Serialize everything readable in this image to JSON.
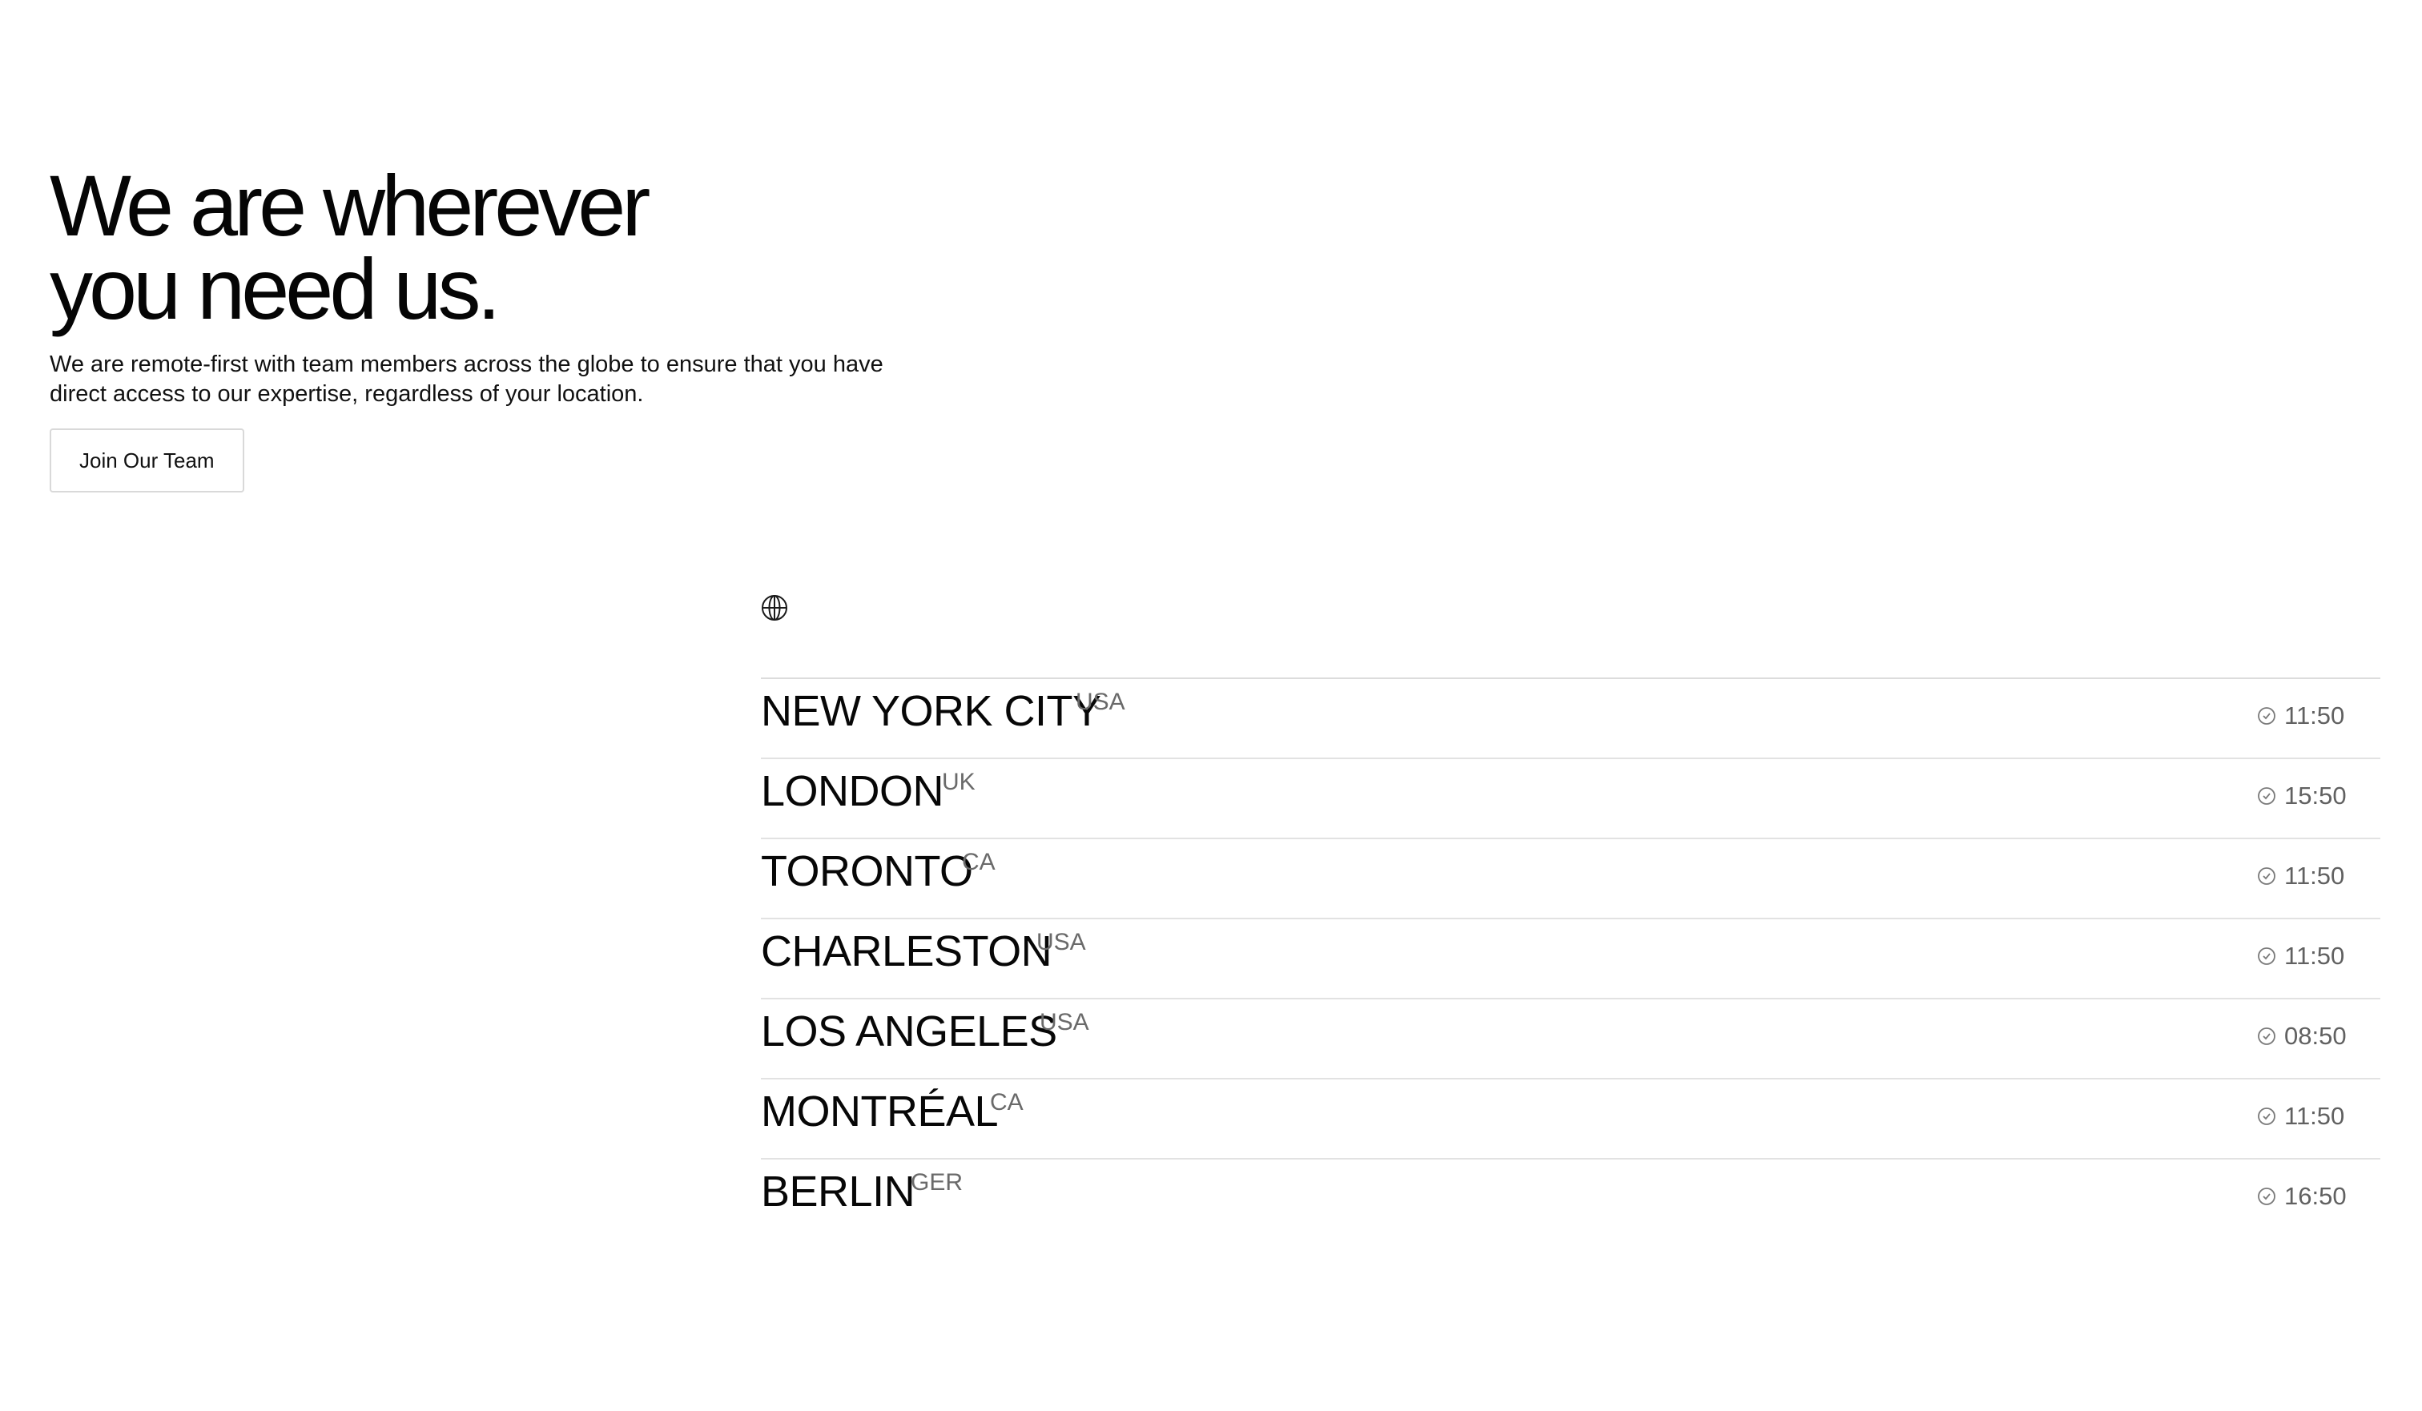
{
  "hero": {
    "title_line1": "We are wherever",
    "title_line2": "you need us.",
    "description": "We are remote-first with team members across the globe to ensure that you have direct access to our expertise, regardless of your location.",
    "cta_label": "Join Our Team"
  },
  "locations": {
    "icon": "globe-icon",
    "time_icon": "clock-icon",
    "cities": [
      {
        "name": "NEW YORK CITY",
        "country": "USA",
        "time": "11:50"
      },
      {
        "name": "LONDON",
        "country": "UK",
        "time": "15:50"
      },
      {
        "name": "TORONTO",
        "country": "CA",
        "time": "11:50"
      },
      {
        "name": "CHARLESTON",
        "country": "USA",
        "time": "11:50"
      },
      {
        "name": "LOS ANGELES",
        "country": "USA",
        "time": "08:50"
      },
      {
        "name": "MONTRÉAL",
        "country": "CA",
        "time": "11:50"
      },
      {
        "name": "BERLIN",
        "country": "GER",
        "time": "16:50"
      }
    ]
  },
  "colors": {
    "text": "#0b0b0b",
    "muted": "#6a6a6a",
    "divider": "#e2e2e2",
    "button_border": "#d9d9d9",
    "background": "#ffffff"
  }
}
